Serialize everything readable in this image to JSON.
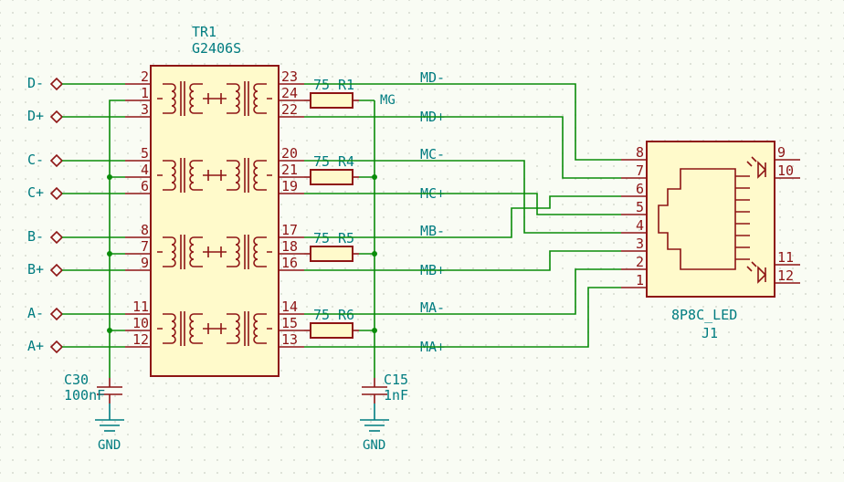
{
  "transformer": {
    "ref": "TR1",
    "value": "G2406S",
    "pins_left": [
      "2",
      "1",
      "3",
      "5",
      "4",
      "6",
      "8",
      "7",
      "9",
      "11",
      "10",
      "12"
    ],
    "pins_right": [
      "23",
      "24",
      "22",
      "20",
      "21",
      "19",
      "17",
      "18",
      "16",
      "14",
      "15",
      "13"
    ]
  },
  "resistors": {
    "R1": {
      "ref": "R1",
      "value": "75"
    },
    "R4": {
      "ref": "R4",
      "value": "75"
    },
    "R5": {
      "ref": "R5",
      "value": "75"
    },
    "R6": {
      "ref": "R6",
      "value": "75"
    }
  },
  "capacitors": {
    "C30": {
      "ref": "C30",
      "value": "100nF"
    },
    "C15": {
      "ref": "C15",
      "value": "1nF"
    }
  },
  "gnd": {
    "label": "GND"
  },
  "connector": {
    "ref": "J1",
    "value": "8P8C_LED",
    "pins_left": [
      "8",
      "7",
      "6",
      "5",
      "4",
      "3",
      "2",
      "1"
    ],
    "pins_right": [
      "9",
      "10",
      "11",
      "12"
    ]
  },
  "nets": {
    "left": [
      "D-",
      "D+",
      "C-",
      "C+",
      "B-",
      "B+",
      "A-",
      "A+"
    ],
    "mid_tap": "MG",
    "right": [
      "MD-",
      "MD+",
      "MC-",
      "MC+",
      "MB-",
      "MB+",
      "MA-",
      "MA+"
    ]
  }
}
